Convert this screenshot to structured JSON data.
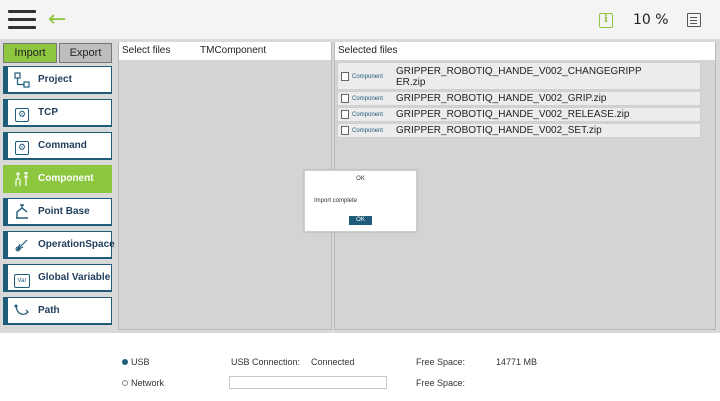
{
  "topbar": {
    "menu_icon": "hamburger-menu-icon",
    "back_icon": "back-arrow-icon",
    "info_icon_char": "i",
    "speed": "10 %",
    "accent": "#8dc63f"
  },
  "tabs": {
    "import": "Import",
    "export": "Export"
  },
  "sidebar": {
    "items": [
      {
        "label": "Project",
        "icon": "project-icon"
      },
      {
        "label": "TCP",
        "icon": "tcp-icon"
      },
      {
        "label": "Command",
        "icon": "command-icon"
      },
      {
        "label": "Component",
        "icon": "component-icon",
        "active": true
      },
      {
        "label": "Point Base",
        "icon": "point-base-icon"
      },
      {
        "label_line1": "Operation",
        "label_line2": "Space",
        "icon": "operation-space-icon"
      },
      {
        "label": "Global Variable",
        "icon": "global-variable-icon",
        "icon_text": "Var"
      },
      {
        "label": "Path",
        "icon": "path-icon"
      }
    ],
    "active_color": "#8dc63f",
    "border_color": "#1f5c7a"
  },
  "select_panel": {
    "title": "Select files",
    "subtitle": "TMComponent"
  },
  "selected_panel": {
    "title": "Selected files",
    "files": [
      {
        "type": "Component",
        "name_line1": "GRIPPER_ROBOTIQ_HANDE_V002_CHANGEGRIPP",
        "name_line2": "ER.zip"
      },
      {
        "type": "Component",
        "name": "GRIPPER_ROBOTIQ_HANDE_V002_GRIP.zip"
      },
      {
        "type": "Component",
        "name": "GRIPPER_ROBOTIQ_HANDE_V002_RELEASE.zip"
      },
      {
        "type": "Component",
        "name": "GRIPPER_ROBOTIQ_HANDE_V002_SET.zip"
      }
    ]
  },
  "dialog": {
    "title": "OK",
    "message": "Import complete",
    "button": "OK"
  },
  "bottom": {
    "usb_label": "USB",
    "network_label": "Network",
    "usb_connection_label": "USB Connection:",
    "usb_connection_value": "Connected",
    "free_space_label": "Free Space:",
    "free_space_value": "14771 MB",
    "free_space_label_2": "Free Space:",
    "network_value": ""
  }
}
